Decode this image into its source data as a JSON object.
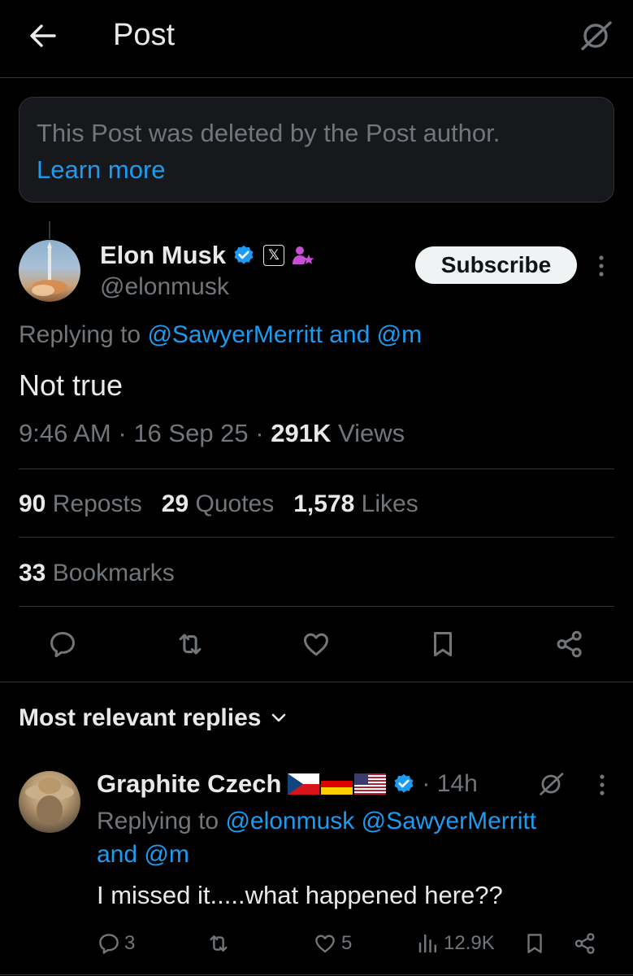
{
  "header": {
    "title": "Post",
    "back_icon": "arrow-left-icon",
    "grok_icon": "grok-icon"
  },
  "deleted_notice": {
    "text": "This Post was deleted by the Post author.",
    "link": "Learn more"
  },
  "post": {
    "author_name": "Elon Musk",
    "author_handle": "@elonmusk",
    "x_badge": "𝕏",
    "subscribe_label": "Subscribe",
    "replying_prefix": "Replying to",
    "replying_mentions": "@SawyerMerritt and @m",
    "text": "Not true",
    "time": "9:46 AM",
    "date": "16 Sep 25",
    "views_count": "291K",
    "views_label": "Views",
    "stats": {
      "reposts_count": "90",
      "reposts_label": "Reposts",
      "quotes_count": "29",
      "quotes_label": "Quotes",
      "likes_count": "1,578",
      "likes_label": "Likes",
      "bookmarks_count": "33",
      "bookmarks_label": "Bookmarks"
    },
    "actions": [
      "reply-icon",
      "repost-icon",
      "like-icon",
      "bookmark-icon",
      "share-icon"
    ]
  },
  "replies_section": {
    "sort_label": "Most relevant replies"
  },
  "reply": {
    "name": "Graphite Czech",
    "flags": [
      "Czech Republic",
      "Germany",
      "United States"
    ],
    "time": "· 14h",
    "replying_prefix": "Replying to",
    "replying_mentions_line1": "@elonmusk @SawyerMerritt",
    "replying_mentions_line2": "and @m",
    "text": "I missed it.....what happened here??",
    "reply_count": "3",
    "like_count": "5",
    "views_count": "12.9K"
  },
  "colors": {
    "accent": "#1d9bf0",
    "muted": "#71767b",
    "text": "#e7e9ea",
    "background": "#000000",
    "border": "#2f3336"
  }
}
